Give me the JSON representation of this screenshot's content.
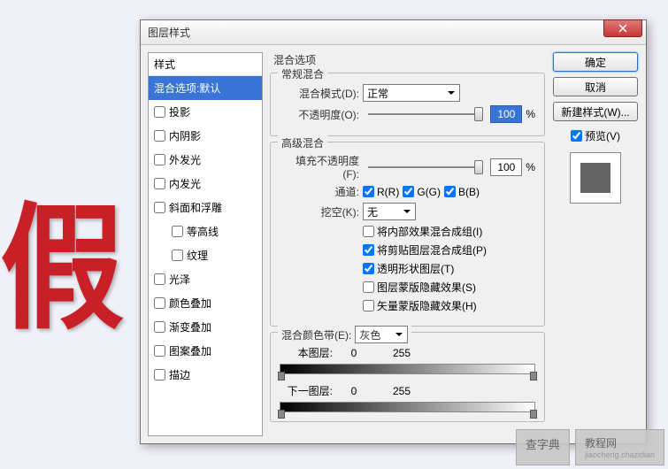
{
  "bg_text": "假",
  "dialog": {
    "title": "图层样式",
    "close_icon": "x"
  },
  "styles": {
    "header": "样式",
    "items": [
      {
        "label": "混合选项:默认",
        "selected": true,
        "checkbox": false
      },
      {
        "label": "投影",
        "checkbox": true
      },
      {
        "label": "内阴影",
        "checkbox": true
      },
      {
        "label": "外发光",
        "checkbox": true
      },
      {
        "label": "内发光",
        "checkbox": true
      },
      {
        "label": "斜面和浮雕",
        "checkbox": true
      },
      {
        "label": "等高线",
        "checkbox": true,
        "indent": true
      },
      {
        "label": "纹理",
        "checkbox": true,
        "indent": true
      },
      {
        "label": "光泽",
        "checkbox": true
      },
      {
        "label": "颜色叠加",
        "checkbox": true
      },
      {
        "label": "渐变叠加",
        "checkbox": true
      },
      {
        "label": "图案叠加",
        "checkbox": true
      },
      {
        "label": "描边",
        "checkbox": true
      }
    ]
  },
  "blend_options": {
    "title": "混合选项",
    "general": {
      "title": "常规混合",
      "mode_label": "混合模式(D):",
      "mode_value": "正常",
      "opacity_label": "不透明度(O):",
      "opacity_value": "100",
      "opacity_unit": "%"
    },
    "advanced": {
      "title": "高级混合",
      "fill_label": "填充不透明度(F):",
      "fill_value": "100",
      "fill_unit": "%",
      "channels_label": "通道:",
      "channel_r": "R(R)",
      "channel_g": "G(G)",
      "channel_b": "B(B)",
      "knockout_label": "挖空(K):",
      "knockout_value": "无",
      "cb1": "将内部效果混合成组(I)",
      "cb2": "将剪贴图层混合成组(P)",
      "cb3": "透明形状图层(T)",
      "cb4": "图层蒙版隐藏效果(S)",
      "cb5": "矢量蒙版隐藏效果(H)"
    },
    "blend_if": {
      "title": "混合颜色带(E):",
      "value": "灰色",
      "this_layer": "本图层:",
      "this_low": "0",
      "this_high": "255",
      "under_layer": "下一图层:",
      "under_low": "0",
      "under_high": "255"
    }
  },
  "buttons": {
    "ok": "确定",
    "cancel": "取消",
    "new_style": "新建样式(W)...",
    "preview": "预览(V)"
  },
  "watermark": {
    "box1": "查字典",
    "box2": "教程网",
    "sub": "jiaocheng.chazidian"
  }
}
